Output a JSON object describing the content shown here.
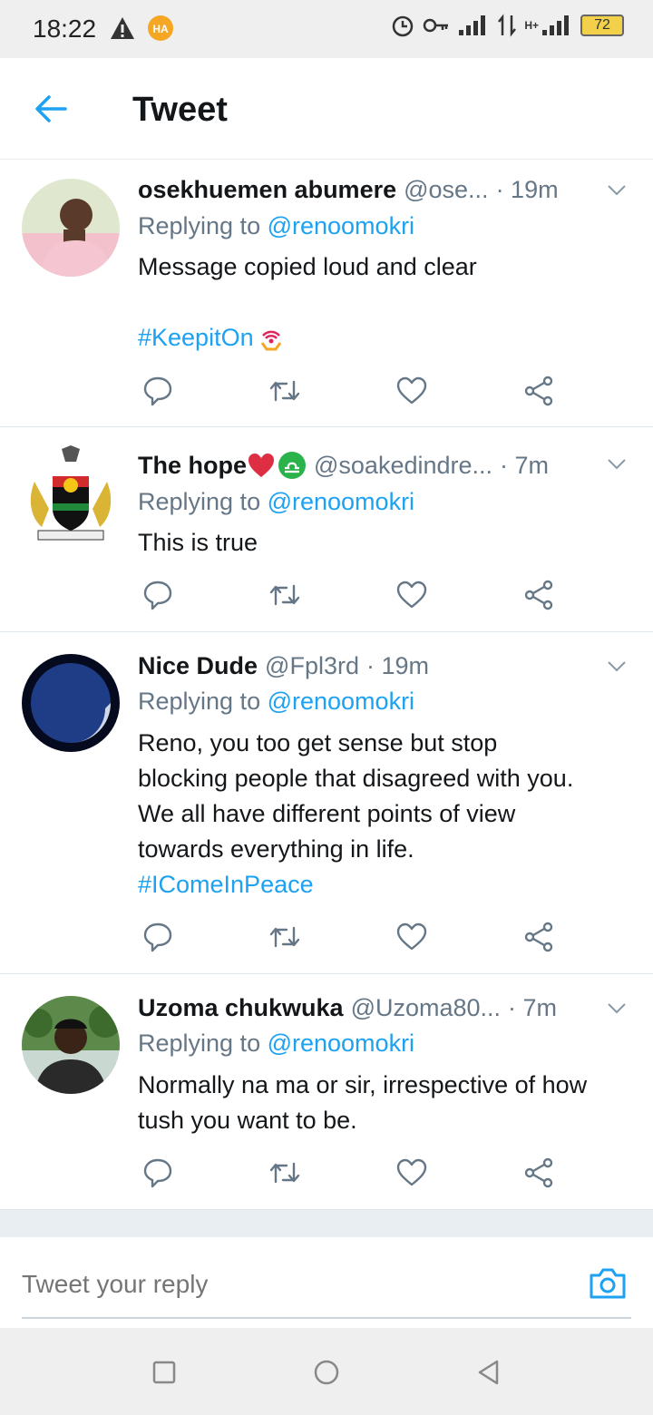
{
  "status_bar": {
    "time": "18:22",
    "network_type": "H+",
    "battery": "72"
  },
  "header": {
    "title": "Tweet"
  },
  "tweets": [
    {
      "name": "osekhuemen abumere",
      "handle": "@ose...",
      "time": "· 19m",
      "reply_prefix": "Replying to ",
      "reply_to": "@renoomokri",
      "text_lines": [
        "Message copied loud and clear"
      ],
      "hashtag": "#KeepitOn"
    },
    {
      "name": "The hope",
      "handle": "@soakedindre...",
      "time": "· 7m",
      "reply_prefix": "Replying to ",
      "reply_to": "@renoomokri",
      "text_lines": [
        "This is true"
      ]
    },
    {
      "name": "Nice Dude",
      "handle": "@Fpl3rd",
      "time": "· 19m",
      "reply_prefix": "Replying to ",
      "reply_to": "@renoomokri",
      "text_lines": [
        "Reno, you too get sense but stop",
        "blocking people that disagreed with you.",
        "We all have different points of view",
        "towards everything in life."
      ],
      "hashtag": "#IComeInPeace"
    },
    {
      "name": "Uzoma chukwuka",
      "handle": "@Uzoma80...",
      "time": "· 7m",
      "reply_prefix": "Replying to ",
      "reply_to": "@renoomokri",
      "text_lines": [
        "Normally na ma or sir, irrespective of how",
        "tush you want to be."
      ]
    }
  ],
  "reply_bar": {
    "placeholder": "Tweet your reply"
  },
  "colors": {
    "accent": "#1da1f2",
    "muted": "#657786",
    "text": "#14171a"
  }
}
